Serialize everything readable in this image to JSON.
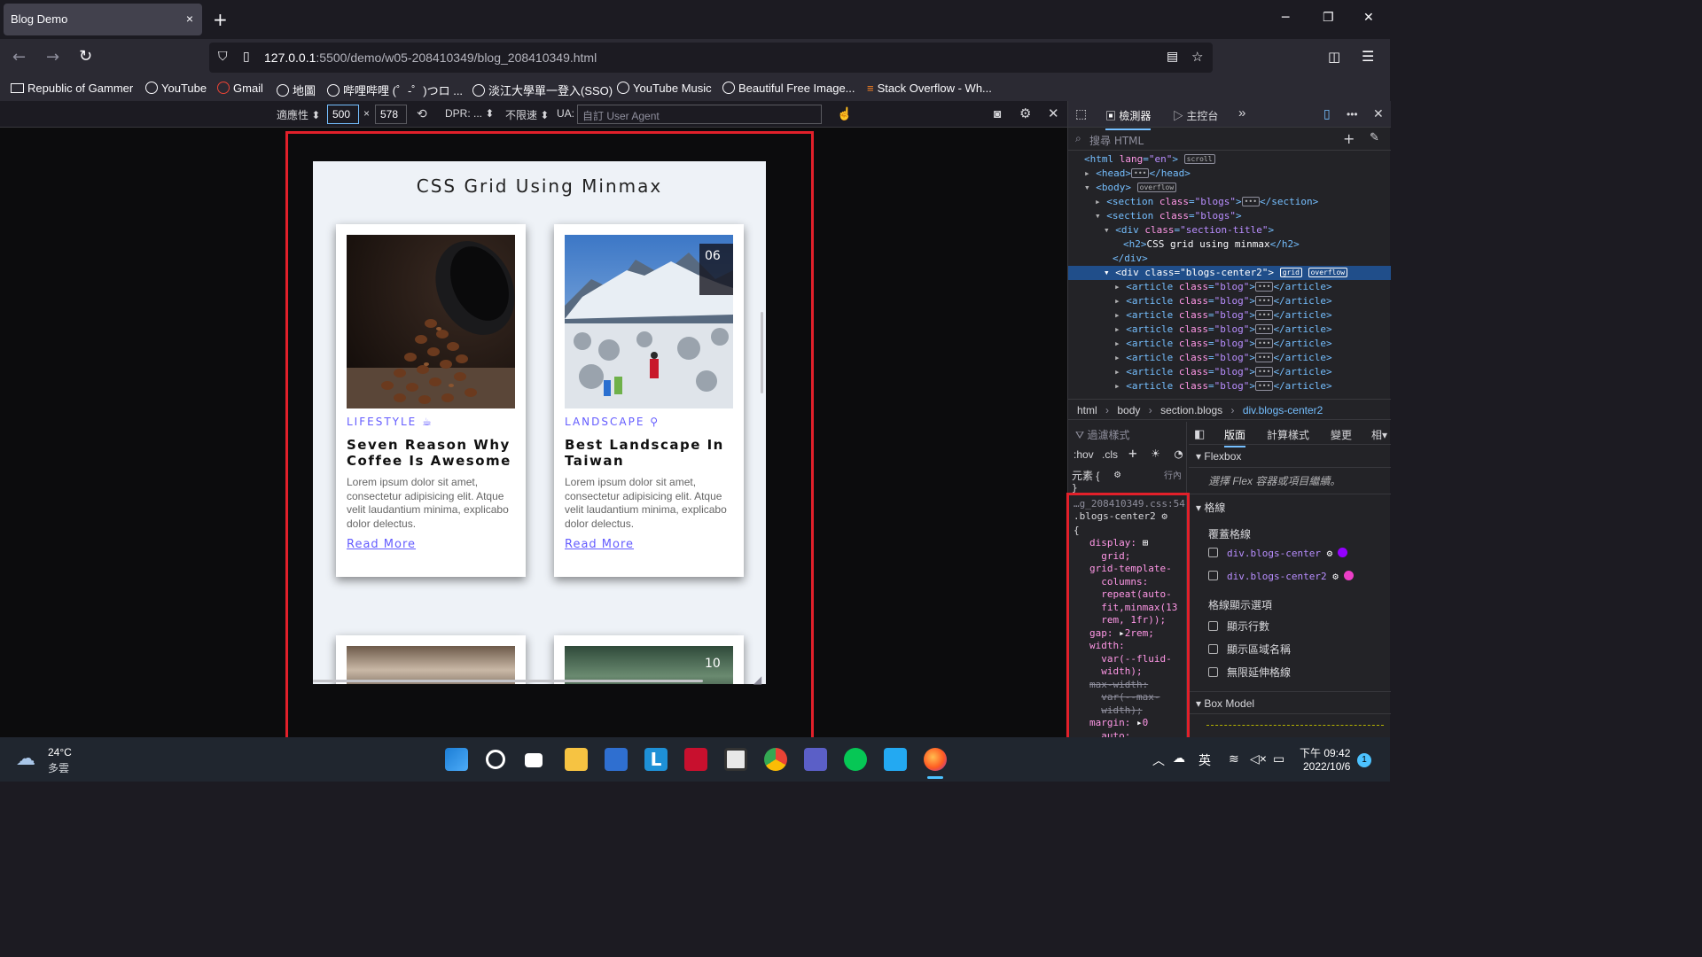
{
  "browser": {
    "tab_title": "Blog Demo",
    "tab_close": "×",
    "new_tab": "+",
    "url_host": "127.0.0.1",
    "url_path": ":5500/demo/w05-208410349/blog_208410349.html",
    "bookmarks": [
      "Republic of Gammer",
      "YouTube",
      "Gmail",
      "地圖",
      "哔哩哔哩 (゜-゜)つロ ...",
      "淡江大學單一登入(SSO)",
      "YouTube Music",
      "Beautiful Free Image...",
      "Stack Overflow - Wh..."
    ]
  },
  "rdm": {
    "responsive": "適應性 ⬍",
    "width": "500",
    "times": "×",
    "height": "578",
    "dpr": "DPR: ...",
    "throttle": "不限速",
    "ua_label": "UA:",
    "ua_placeholder": "自訂 User Agent"
  },
  "page": {
    "title": "CSS Grid Using Minmax",
    "cards": [
      {
        "category": "LIFESTYLE",
        "title": "Seven Reason Why Coffee Is Awesome",
        "text": "Lorem ipsum dolor sit amet, consectetur adipisicing elit. Atque velit laudantium minima, explicabo dolor delectus.",
        "link": "Read More"
      },
      {
        "category": "LANDSCAPE",
        "title": "Best Landscape In Taiwan",
        "text": "Lorem ipsum dolor sit amet, consectetur adipisicing elit. Atque velit laudantium minima, explicabo dolor delectus.",
        "link": "Read More"
      }
    ],
    "calendar_day1": "06",
    "calendar_day2": "10"
  },
  "devtools": {
    "tab_inspector": "檢測器",
    "tab_console": "主控台",
    "search_placeholder": "搜尋 HTML",
    "crumbs": [
      "html",
      "body",
      "section.blogs",
      "div.blogs-center2"
    ],
    "filter_placeholder": "過濾樣式",
    "hov": ":hov",
    "cls": ".cls",
    "element_rule": "元素 {",
    "inline": "行內",
    "file_ref": "…g_208410349.css:54",
    "selector": ".blogs-center2",
    "layout_tabs": [
      "版面",
      "計算樣式",
      "變更",
      "相"
    ],
    "flexbox_title": "Flexbox",
    "flexbox_hint": "選擇 Flex 容器或項目繼續。",
    "grid_title": "格線",
    "overlay_title": "覆蓋格線",
    "grid_items": [
      "div.blogs-center",
      "div.blogs-center2"
    ],
    "grid_options_title": "格線顯示選項",
    "grid_options": [
      "顯示行數",
      "顯示區域名稱",
      "無限延伸格線"
    ],
    "boxmodel_title": "Box Model"
  },
  "taskbar": {
    "temp": "24°C",
    "weather": "多雲",
    "ime": "英",
    "time": "下午 09:42",
    "date": "2022/10/6",
    "notif": "1"
  },
  "colors": {
    "accent": "#645cff",
    "highlight_red": "#e2202a",
    "selected_row": "#204e8a"
  }
}
